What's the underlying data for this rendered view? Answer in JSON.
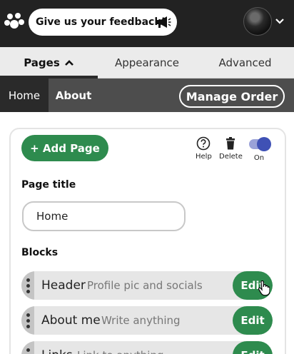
{
  "header": {
    "feedback_label": "Give us your feedback!",
    "logo_icon": "paw-logo-icon",
    "megaphone_icon": "megaphone-icon",
    "chevron_icon": "chevron-down-icon"
  },
  "tabs": [
    {
      "label": "Pages",
      "active": true
    },
    {
      "label": "Appearance",
      "active": false
    },
    {
      "label": "Advanced",
      "active": false
    }
  ],
  "subnav": {
    "items": [
      {
        "label": "Home",
        "active": true
      },
      {
        "label": "About",
        "active": false
      }
    ],
    "manage_label": "Manage Order"
  },
  "editor": {
    "add_page_label": "+ Add Page",
    "tools": [
      {
        "icon": "help-icon",
        "label": "Help"
      },
      {
        "icon": "trash-icon",
        "label": "Delete"
      },
      {
        "icon": "toggle",
        "label": "On"
      }
    ],
    "page_title_label": "Page title",
    "page_title_value": "Home",
    "blocks_label": "Blocks",
    "edit_label": "Edit",
    "blocks": [
      {
        "name": "Header",
        "desc": "Profile pic and socials"
      },
      {
        "name": "About me",
        "desc": "Write anything"
      },
      {
        "name": "Links",
        "desc": "Link to anything"
      }
    ]
  },
  "colors": {
    "topbar": "#222222",
    "accent_green": "#2e8b4e",
    "toggle": "#3f51b5",
    "subnav": "#4d4d4d"
  }
}
